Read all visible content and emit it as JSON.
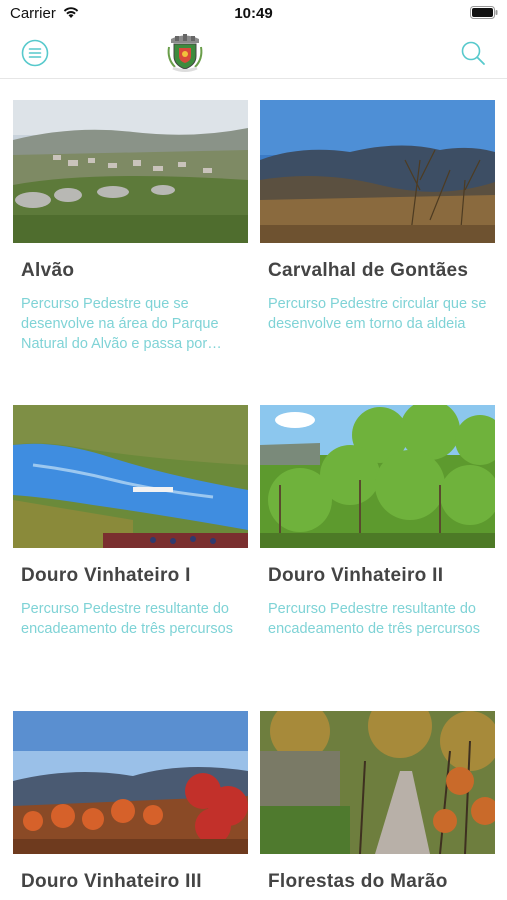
{
  "status_bar": {
    "carrier": "Carrier",
    "time": "10:49"
  },
  "header": {
    "menu_icon": "menu-circle-icon",
    "logo_icon": "municipal-coat-of-arms",
    "search_icon": "search-icon",
    "accent_color": "#57c9cc"
  },
  "routes": [
    {
      "title": "Alvão",
      "description": "Percurso Pedestre que se desenvolve na área do Parque Natural do Alvão e passa por aldeias serranas",
      "image": "mountain-village-photo"
    },
    {
      "title": "Carvalhal de Gontães",
      "description": "Percurso Pedestre circular que se desenvolve em torno da aldeia",
      "image": "mountain-valley-photo"
    },
    {
      "title": "Douro Vinhateiro I",
      "description": "Percurso Pedestre resultante do encadeamento de três percursos",
      "image": "douro-river-vineyards-photo"
    },
    {
      "title": "Douro Vinhateiro II",
      "description": "Percurso Pedestre resultante do encadeamento de três percursos",
      "image": "grapevines-photo"
    },
    {
      "title": "Douro Vinhateiro III",
      "description": "",
      "image": "autumn-vineyard-photo"
    },
    {
      "title": "Florestas do Marão",
      "description": "",
      "image": "forest-path-photo"
    }
  ]
}
